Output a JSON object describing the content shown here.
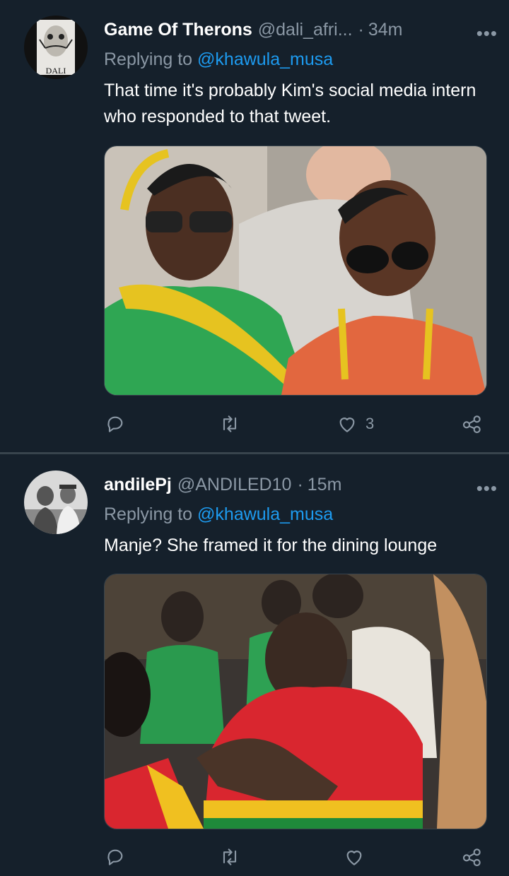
{
  "tweets": [
    {
      "display_name": "Game Of Therons",
      "handle": "@dali_afri...",
      "separator": "·",
      "time": "34m",
      "more_label": "•••",
      "replying_prefix": "Replying to",
      "replying_to": "@khawula_musa",
      "text": "That time it's probably Kim's social media intern who responded to that tweet.",
      "avatar_text": "DALI",
      "likes": "3",
      "icons": [
        "reply-icon",
        "retweet-icon",
        "like-icon",
        "share-icon"
      ]
    },
    {
      "display_name": "andilePj",
      "handle": "@ANDILED10",
      "separator": "·",
      "time": "15m",
      "more_label": "•••",
      "replying_prefix": "Replying to",
      "replying_to": "@khawula_musa",
      "text": "Manje? She framed it for the dining lounge",
      "likes": "",
      "icons": [
        "reply-icon",
        "retweet-icon",
        "like-icon",
        "share-icon"
      ]
    }
  ],
  "colors": {
    "background": "#15202b",
    "text_primary": "#ffffff",
    "text_secondary": "#8b98a5",
    "link": "#1d9bf0",
    "divider": "#38444d"
  }
}
